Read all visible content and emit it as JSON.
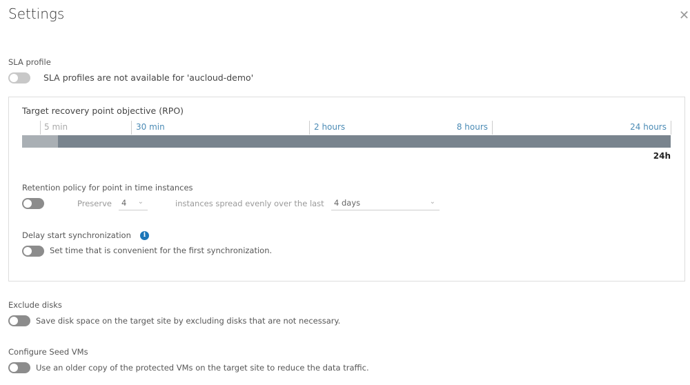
{
  "title": "Settings",
  "sla": {
    "heading": "SLA profile",
    "text": "SLA profiles are not available for 'aucloud-demo'"
  },
  "rpo": {
    "heading": "Target recovery point objective (RPO)",
    "ticks": [
      "5 min",
      "30 min",
      "2 hours",
      "8 hours",
      "24 hours"
    ],
    "value": "24h",
    "fill_fraction": 0.055
  },
  "retention": {
    "heading": "Retention policy for point in time instances",
    "preserve": "Preserve",
    "count": "4",
    "spread": "instances spread evenly over the last",
    "period": "4 days"
  },
  "delay": {
    "heading": "Delay start synchronization",
    "text": "Set time that is convenient for the first synchronization."
  },
  "exclude": {
    "heading": "Exclude disks",
    "text": "Save disk space on the target site by excluding disks that are not necessary."
  },
  "seed": {
    "heading": "Configure Seed VMs",
    "text": "Use an older copy of the protected VMs on the target site to reduce the data traffic."
  }
}
